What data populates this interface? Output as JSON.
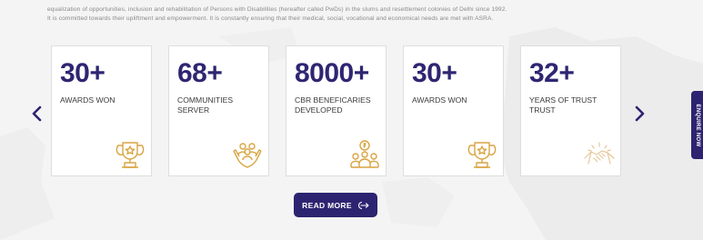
{
  "intro": {
    "line1": "equalization of opportunities, inclusion and rehabilitation of Persons with Disabilities (hereafter called PwDs) in the slums and resettlement colonies of Delhi since 1992.",
    "line2": "It is committed towards their upliftment and empowerment. It is constantly ensuring that their medical, social, vocational and economical needs are met with ASRA."
  },
  "stats": [
    {
      "number": "30+",
      "label": "AWARDS WON",
      "icon": "trophy-icon"
    },
    {
      "number": "68+",
      "label": "COMMUNITIES SERVER",
      "icon": "community-hands-icon"
    },
    {
      "number": "8000+",
      "label": "CBR BENEFICARIES DEVELOPED",
      "icon": "beneficiaries-icon"
    },
    {
      "number": "30+",
      "label": "AWARDS WON",
      "icon": "trophy-icon"
    },
    {
      "number": "32+",
      "label": "YEARS OF TRUST TRUST",
      "icon": "handshake-icon"
    }
  ],
  "read_more": {
    "label": "READ MORE",
    "icon": "arrow-exit-icon"
  },
  "enquire": {
    "label": "ENQUIRE NOW"
  },
  "colors": {
    "brand": "#2c2470",
    "number": "#2e2672",
    "icon_gold": "#d9a441",
    "background": "#f4f4f4"
  }
}
